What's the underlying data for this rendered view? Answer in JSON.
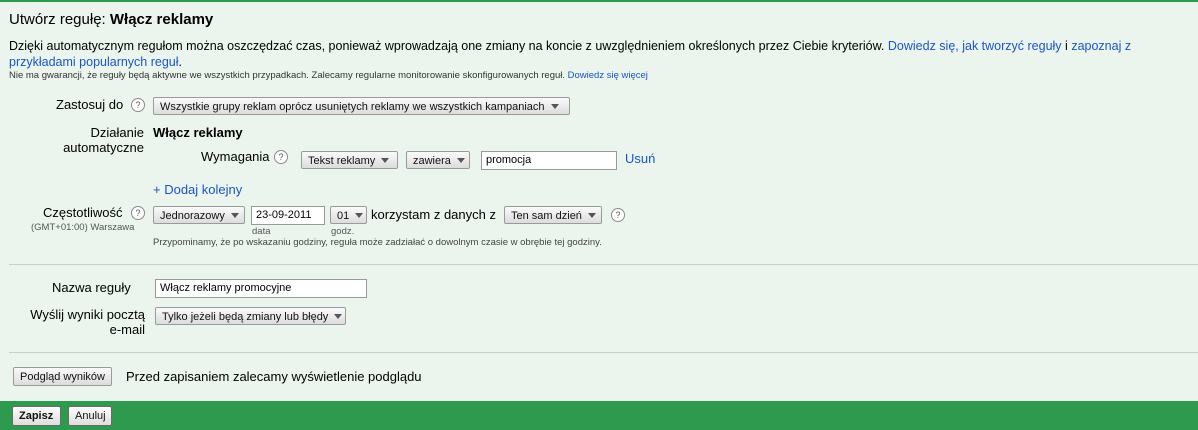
{
  "header": {
    "title_prefix": "Utwórz regułę:",
    "title_bold": "Włącz reklamy"
  },
  "description": {
    "text": "Dzięki automatycznym regułom można oszczędzać czas, ponieważ wprowadzają one zmiany na koncie z uwzględnieniem określonych przez Ciebie kryteriów.",
    "link1": "Dowiedz się, jak tworzyć reguły",
    "connector": "i",
    "link2": "zapoznaj z przykładami popularnych reguł",
    "tail": ".",
    "note": "Nie ma gwarancji, że reguły będą aktywne we wszystkich przypadkach. Zalecamy regularne monitorowanie skonfigurowanych reguł.",
    "note_link": "Dowiedz się więcej"
  },
  "apply_to": {
    "label": "Zastosuj do",
    "value": "Wszystkie grupy reklam oprócz usuniętych reklamy we wszystkich kampaniach"
  },
  "action": {
    "label_line1": "Działanie",
    "label_line2": "automatyczne",
    "value": "Włącz reklamy",
    "requirements_label": "Wymagania",
    "req_field": "Tekst reklamy",
    "req_operator": "zawiera",
    "req_value": "promocja",
    "remove_link": "Usuń",
    "add_link": "+ Dodaj kolejny"
  },
  "frequency": {
    "label": "Częstotliwość",
    "timezone": "(GMT+01:00) Warszawa",
    "value": "Jednorazowy",
    "date": "23-09-2011",
    "date_caption": "data",
    "hour": "01",
    "hour_caption": "godz.",
    "data_text": "korzystam z danych z",
    "data_range": "Ten sam dzień",
    "reminder": "Przypominamy, że po wskazaniu godziny, reguła może zadziałać o dowolnym czasie w obrębie tej godziny."
  },
  "rule_name": {
    "label": "Nazwa reguły",
    "value": "Włącz reklamy promocyjne"
  },
  "email": {
    "label_line1": "Wyślij wyniki pocztą",
    "label_line2": "e-mail",
    "value": "Tylko jeżeli będą zmiany lub błędy"
  },
  "preview": {
    "button": "Podgląd wyników",
    "hint": "Przed zapisaniem zalecamy wyświetlenie podglądu"
  },
  "footer": {
    "save": "Zapisz",
    "cancel": "Anuluj"
  },
  "icons": {
    "help": "?"
  }
}
